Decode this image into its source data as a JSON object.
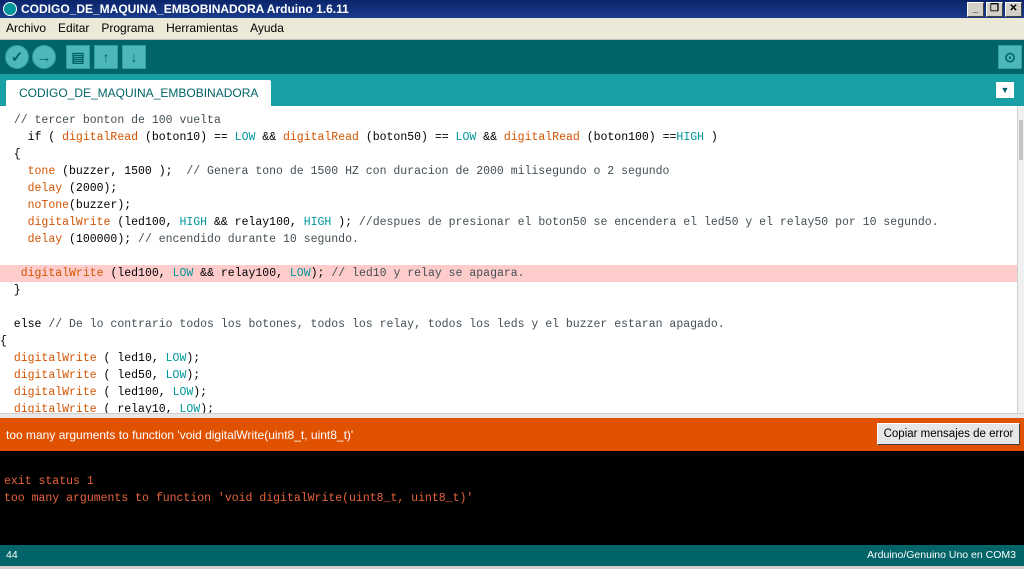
{
  "window": {
    "title": "CODIGO_DE_MAQUINA_EMBOBINADORA Arduino 1.6.11",
    "minimize": "_",
    "restore": "❐",
    "close": "✕"
  },
  "menu": [
    "Archivo",
    "Editar",
    "Programa",
    "Herramientas",
    "Ayuda"
  ],
  "toolbar": {
    "verify": "✓",
    "upload": "→",
    "new": "▤",
    "open": "↑",
    "save": "↓",
    "serial_monitor": "⊙"
  },
  "tab": {
    "label": "CODIGO_DE_MAQUINA_EMBOBINADORA",
    "menu_icon": "▼"
  },
  "code": [
    {
      "text": "  // tercer bonton de 100 vuelta",
      "highlight": false
    },
    {
      "text": "    if ( digitalRead (boton10) == LOW && digitalRead (boton50) == LOW && digitalRead (boton100) ==HIGH )",
      "highlight": false
    },
    {
      "text": "  {",
      "highlight": false
    },
    {
      "text": "    tone (buzzer, 1500 );  // Genera tono de 1500 HZ con duracion de 2000 milisegundo o 2 segundo",
      "highlight": false
    },
    {
      "text": "    delay (2000);",
      "highlight": false
    },
    {
      "text": "    noTone(buzzer);",
      "highlight": false
    },
    {
      "text": "    digitalWrite (led100, HIGH && relay100, HIGH ); //despues de presionar el boton50 se encendera el led50 y el relay50 por 10 segundo.",
      "highlight": false
    },
    {
      "text": "    delay (100000); // encendido durante 10 segundo.",
      "highlight": false
    },
    {
      "text": "",
      "highlight": false
    },
    {
      "text": "   digitalWrite (led100, LOW && relay100, LOW); // led10 y relay se apagara.",
      "highlight": true
    },
    {
      "text": "  }",
      "highlight": false
    },
    {
      "text": "",
      "highlight": false
    },
    {
      "text": "  else // De lo contrario todos los botones, todos los relay, todos los leds y el buzzer estaran apagado.",
      "highlight": false
    },
    {
      "text": "{",
      "highlight": false
    },
    {
      "text": "  digitalWrite ( led10, LOW);",
      "highlight": false
    },
    {
      "text": "  digitalWrite ( led50, LOW);",
      "highlight": false
    },
    {
      "text": "  digitalWrite ( led100, LOW);",
      "highlight": false
    },
    {
      "text": "  digitalWrite ( relay10, LOW);",
      "highlight": false
    }
  ],
  "error_bar": {
    "message": "too many arguments to function 'void digitalWrite(uint8_t, uint8_t)'",
    "copy_button": "Copiar mensajes de error"
  },
  "console": [
    "exit status 1",
    "too many arguments to function 'void digitalWrite(uint8_t, uint8_t)'"
  ],
  "status": {
    "line": "44",
    "board": "Arduino/Genuino Uno en COM3"
  },
  "colors": {
    "teal_dark": "#006468",
    "teal": "#17a1a5",
    "error": "#e05100",
    "highlight": "#ffcccc"
  }
}
